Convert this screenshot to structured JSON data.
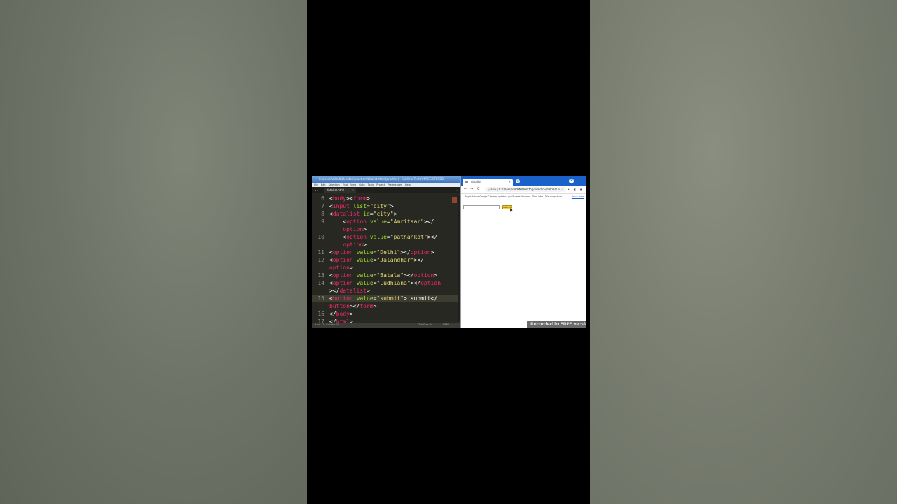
{
  "editor": {
    "title": "C:\\Users\\VARAN\\Desktop\\practice\\datalist.html (practice) - Sublime Text (UNREGISTERED)",
    "menu": [
      "File",
      "Edit",
      "Selection",
      "Find",
      "View",
      "Goto",
      "Tools",
      "Project",
      "Preferences",
      "Help"
    ],
    "nav": "◂ ▸",
    "tab_label": "datalist.html",
    "tab_close": "×",
    "tab_menu": "▾",
    "status_left": "Line 15, Column 40",
    "status_mid": "Tab Size: 4",
    "status_right": "HTML",
    "lines": [
      {
        "num": "6",
        "parts": [
          "<",
          "body",
          "><",
          "form",
          ">"
        ]
      },
      {
        "num": "7",
        "parts": [
          "<",
          "input",
          " ",
          "list",
          "=",
          "\"city\"",
          ">"
        ]
      },
      {
        "num": "8",
        "parts": [
          "<",
          "datalist",
          " ",
          "id",
          "=",
          "\"city\"",
          ">"
        ]
      },
      {
        "num": "9",
        "parts": [
          "    <",
          "option",
          " ",
          "value",
          "=",
          "\"Amritsar\"",
          "></"
        ]
      },
      {
        "num": "",
        "parts": [
          "    ",
          "option",
          ">"
        ]
      },
      {
        "num": "10",
        "parts": [
          "    <",
          "option",
          " ",
          "value",
          "=",
          "\"pathankot\"",
          "></"
        ]
      },
      {
        "num": "",
        "parts": [
          "    ",
          "option",
          ">"
        ]
      },
      {
        "num": "11",
        "parts": [
          "<",
          "option",
          " ",
          "value",
          "=",
          "\"Delhi\"",
          "></",
          "option",
          ">"
        ]
      },
      {
        "num": "12",
        "parts": [
          "<",
          "option",
          " ",
          "value",
          "=",
          "\"Jalandhar\"",
          "></"
        ]
      },
      {
        "num": "",
        "parts": [
          "",
          "option",
          ">"
        ]
      },
      {
        "num": "13",
        "parts": [
          "<",
          "option",
          " ",
          "value",
          "=",
          "\"Batala\"",
          "></",
          "option",
          ">"
        ]
      },
      {
        "num": "14",
        "parts": [
          "<",
          "option",
          " ",
          "value",
          "=",
          "\"Ludhiana\"",
          "></",
          "option"
        ]
      },
      {
        "num": "",
        "parts": [
          ">",
          "</",
          "datalist",
          ">"
        ]
      },
      {
        "num": "15",
        "parts": [
          "<",
          "button",
          " ",
          "value",
          "=",
          "\"submit\"",
          "> submit</"
        ]
      },
      {
        "num": "",
        "parts": [
          "",
          "button",
          "></",
          "form",
          ">"
        ]
      },
      {
        "num": "16",
        "parts": [
          "</",
          "body",
          ">"
        ]
      },
      {
        "num": "17",
        "parts": [
          "</",
          "html",
          ">"
        ]
      }
    ]
  },
  "browser": {
    "tab_title": "datalist",
    "tab_close": "×",
    "new_tab": "+",
    "window_close": "×",
    "back": "←",
    "forward": "→",
    "reload": "C",
    "url": "ⓘ File | C:/Users/VARAN/Desktop/practice/datalist.h...",
    "toolbar_icons": "☆ ★ ◧ ●",
    "infobar_text": "To get future Google Chrome updates, you'll need Windows 10 or later. This computer i...",
    "infobar_link": "Learn more",
    "button_label": "submit"
  },
  "watermark": "Recorded in FREE version"
}
